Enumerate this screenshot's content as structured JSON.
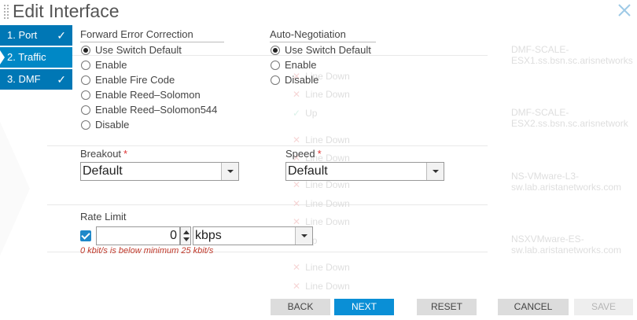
{
  "title": "Edit Interface",
  "steps": [
    {
      "label": "1. Port",
      "done": true
    },
    {
      "label": "2. Traffic",
      "done": false
    },
    {
      "label": "3. DMF",
      "done": true
    }
  ],
  "fec": {
    "label": "Forward Error Correction",
    "options": [
      "Use Switch Default",
      "Enable",
      "Enable Fire Code",
      "Enable Reed–Solomon",
      "Enable Reed–Solomon544",
      "Disable"
    ],
    "selected": "Use Switch Default"
  },
  "autoneg": {
    "label": "Auto-Negotiation",
    "options": [
      "Use Switch Default",
      "Enable",
      "Disable"
    ],
    "selected": "Use Switch Default"
  },
  "breakout": {
    "label": "Breakout",
    "required_mark": "*",
    "value": "Default"
  },
  "speed": {
    "label": "Speed",
    "required_mark": "*",
    "value": "Default"
  },
  "rate_limit": {
    "label": "Rate Limit",
    "enabled": true,
    "value": "0",
    "unit": "kbps",
    "error": "0 kbit/s is below minimum 25 kbit/s"
  },
  "buttons": {
    "back": "BACK",
    "next": "NEXT",
    "reset": "RESET",
    "cancel": "CANCEL",
    "save": "SAVE"
  },
  "background": {
    "statuses": [
      "Line Down",
      "Line Down",
      "Up",
      "Line Down",
      "Line Down",
      "Line Down",
      "Line Down",
      "Line Down",
      "Up",
      "Line Down",
      "Line Down"
    ],
    "hosts": [
      {
        "name": "DMF-SCALE-",
        "fqdn": "ESX1.ss.bsn.sc.arisnetworks"
      },
      {
        "name": "DMF-SCALE-",
        "fqdn": "ESX2.ss.bsn.sc.arisnetwork"
      },
      {
        "name": "NS-VMware-L3-",
        "fqdn": "sw.lab.aristanetworks.com"
      },
      {
        "name": "NSXVMware-ES-",
        "fqdn": "sw.lab.aristanetworks.com"
      }
    ]
  },
  "colors": {
    "accent": "#0077b5",
    "step_active": "#0088c6",
    "next_button": "#0a8fd6",
    "error": "#c0392b",
    "required": "#d33333"
  },
  "icons": {
    "close": "close-icon",
    "check": "check-icon",
    "drag": "drag-handle-icon"
  }
}
